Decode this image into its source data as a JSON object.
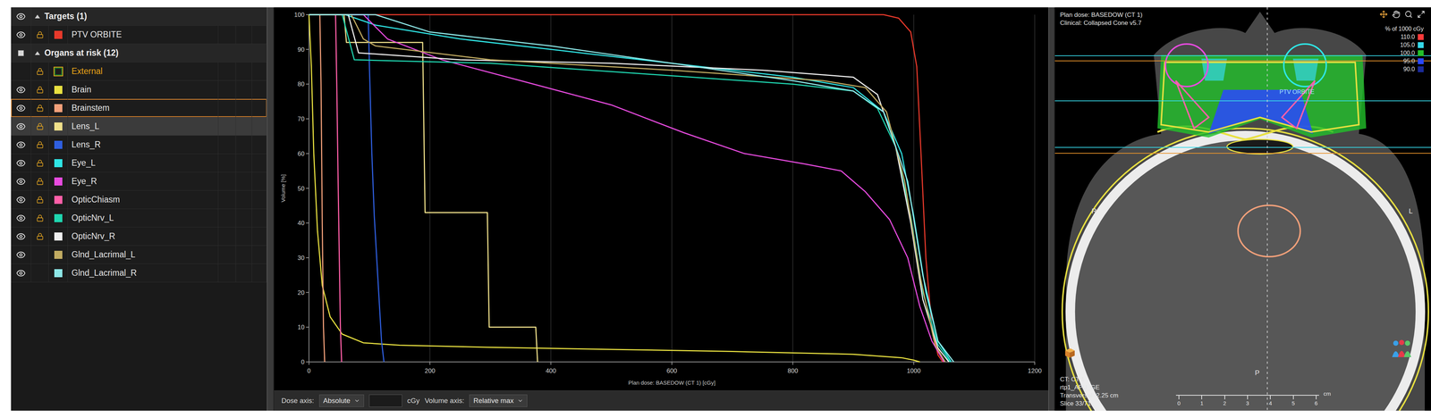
{
  "structures": {
    "groups": [
      {
        "label": "Targets (1)",
        "expanded": true,
        "visibility": "all",
        "items": [
          {
            "name": "PTV ORBITE",
            "color": "#e8392b",
            "text_color": "#e6e6e6",
            "kind": "filled",
            "visible": true,
            "locked": true,
            "selected": false,
            "highlighted": false,
            "dvh": [
              [
                0,
                100
              ],
              [
                950,
                100
              ],
              [
                975,
                99
              ],
              [
                995,
                95
              ],
              [
                1005,
                85
              ],
              [
                1012,
                60
              ],
              [
                1020,
                30
              ],
              [
                1030,
                10
              ],
              [
                1040,
                2
              ],
              [
                1048,
                0
              ]
            ]
          }
        ]
      },
      {
        "label": "Organs at risk (12)",
        "expanded": true,
        "visibility": "partial",
        "items": [
          {
            "name": "External",
            "color": "#1f7a2a",
            "text_color": "#e8a317",
            "kind": "outline",
            "visible": false,
            "locked": true,
            "selected": false,
            "highlighted": false,
            "dvh": []
          },
          {
            "name": "Brain",
            "color": "#e8e040",
            "text_color": "#e6e6e6",
            "kind": "filled",
            "visible": true,
            "locked": true,
            "selected": false,
            "highlighted": false,
            "dvh": [
              [
                0,
                100
              ],
              [
                4,
                85
              ],
              [
                8,
                60
              ],
              [
                14,
                38
              ],
              [
                22,
                22
              ],
              [
                35,
                13
              ],
              [
                55,
                8
              ],
              [
                90,
                5.5
              ],
              [
                150,
                4.8
              ],
              [
                300,
                4.2
              ],
              [
                500,
                3.6
              ],
              [
                700,
                3
              ],
              [
                900,
                2.2
              ],
              [
                980,
                1.2
              ],
              [
                1000,
                0.5
              ],
              [
                1010,
                0
              ]
            ]
          },
          {
            "name": "Brainstem",
            "color": "#f2a07a",
            "text_color": "#e6e6e6",
            "kind": "filled",
            "visible": true,
            "locked": true,
            "selected": true,
            "highlighted": false,
            "dvh": [
              [
                0,
                100
              ],
              [
                18,
                100
              ],
              [
                20,
                80
              ],
              [
                22,
                40
              ],
              [
                24,
                10
              ],
              [
                26,
                0
              ]
            ]
          },
          {
            "name": "Lens_L",
            "color": "#efe08a",
            "text_color": "#e6e6e6",
            "kind": "filled",
            "visible": true,
            "locked": true,
            "selected": false,
            "highlighted": true,
            "dvh": [
              [
                0,
                100
              ],
              [
                58,
                100
              ],
              [
                62,
                92
              ],
              [
                188,
                92
              ],
              [
                192,
                43
              ],
              [
                295,
                43
              ],
              [
                298,
                10
              ],
              [
                375,
                10
              ],
              [
                378,
                0
              ]
            ]
          },
          {
            "name": "Lens_R",
            "color": "#2f5fe0",
            "text_color": "#e6e6e6",
            "kind": "filled",
            "visible": true,
            "locked": true,
            "selected": false,
            "highlighted": false,
            "dvh": [
              [
                0,
                100
              ],
              [
                98,
                100
              ],
              [
                100,
                85
              ],
              [
                104,
                60
              ],
              [
                108,
                42
              ],
              [
                112,
                30
              ],
              [
                116,
                18
              ],
              [
                120,
                6
              ],
              [
                124,
                0
              ]
            ]
          },
          {
            "name": "Eye_L",
            "color": "#2fe6e6",
            "text_color": "#e6e6e6",
            "kind": "filled",
            "visible": true,
            "locked": true,
            "selected": false,
            "highlighted": false,
            "dvh": [
              [
                0,
                100
              ],
              [
                60,
                100
              ],
              [
                110,
                97
              ],
              [
                250,
                93
              ],
              [
                450,
                89
              ],
              [
                650,
                85
              ],
              [
                800,
                82
              ],
              [
                900,
                79
              ],
              [
                950,
                72
              ],
              [
                980,
                60
              ],
              [
                1000,
                42
              ],
              [
                1020,
                20
              ],
              [
                1040,
                6
              ],
              [
                1062,
                0
              ]
            ]
          },
          {
            "name": "Eye_R",
            "color": "#e84be0",
            "text_color": "#e6e6e6",
            "kind": "filled",
            "visible": true,
            "locked": true,
            "selected": false,
            "highlighted": false,
            "dvh": [
              [
                0,
                100
              ],
              [
                90,
                100
              ],
              [
                130,
                93
              ],
              [
                220,
                87
              ],
              [
                350,
                81
              ],
              [
                500,
                74
              ],
              [
                620,
                66
              ],
              [
                720,
                60
              ],
              [
                820,
                57
              ],
              [
                880,
                55
              ],
              [
                920,
                49
              ],
              [
                960,
                41
              ],
              [
                990,
                30
              ],
              [
                1010,
                16
              ],
              [
                1030,
                6
              ],
              [
                1050,
                0
              ]
            ]
          },
          {
            "name": "OpticChiasm",
            "color": "#ff5fa8",
            "text_color": "#e6e6e6",
            "kind": "filled",
            "visible": true,
            "locked": true,
            "selected": false,
            "highlighted": false,
            "dvh": [
              [
                0,
                100
              ],
              [
                44,
                100
              ],
              [
                46,
                80
              ],
              [
                48,
                55
              ],
              [
                50,
                32
              ],
              [
                52,
                10
              ],
              [
                54,
                0
              ]
            ]
          },
          {
            "name": "OpticNrv_L",
            "color": "#1fd6b0",
            "text_color": "#e6e6e6",
            "kind": "filled",
            "visible": true,
            "locked": true,
            "selected": false,
            "highlighted": false,
            "dvh": [
              [
                0,
                100
              ],
              [
                55,
                100
              ],
              [
                75,
                87
              ],
              [
                300,
                86
              ],
              [
                550,
                83
              ],
              [
                800,
                80
              ],
              [
                900,
                78
              ],
              [
                940,
                73
              ],
              [
                970,
                62
              ],
              [
                995,
                42
              ],
              [
                1015,
                20
              ],
              [
                1040,
                5
              ],
              [
                1060,
                0
              ]
            ]
          },
          {
            "name": "OpticNrv_R",
            "color": "#f0f0f0",
            "text_color": "#e6e6e6",
            "kind": "filled",
            "visible": true,
            "locked": true,
            "selected": false,
            "highlighted": false,
            "dvh": [
              [
                0,
                100
              ],
              [
                65,
                100
              ],
              [
                82,
                89
              ],
              [
                250,
                87
              ],
              [
                500,
                86
              ],
              [
                750,
                84
              ],
              [
                900,
                82
              ],
              [
                940,
                77
              ],
              [
                970,
                62
              ],
              [
                995,
                40
              ],
              [
                1015,
                18
              ],
              [
                1040,
                4
              ],
              [
                1058,
                0
              ]
            ]
          },
          {
            "name": "Glnd_Lacrimal_L",
            "color": "#c2ac62",
            "text_color": "#e6e6e6",
            "kind": "filled",
            "visible": true,
            "locked": false,
            "selected": false,
            "highlighted": false,
            "dvh": [
              [
                0,
                100
              ],
              [
                70,
                100
              ],
              [
                90,
                93
              ],
              [
                110,
                91
              ],
              [
                300,
                87
              ],
              [
                600,
                84
              ],
              [
                850,
                81
              ],
              [
                920,
                79
              ],
              [
                955,
                72
              ],
              [
                985,
                52
              ],
              [
                1010,
                25
              ],
              [
                1035,
                5
              ],
              [
                1052,
                0
              ]
            ]
          },
          {
            "name": "Glnd_Lacrimal_R",
            "color": "#8ee8e8",
            "text_color": "#e6e6e6",
            "kind": "filled",
            "visible": true,
            "locked": false,
            "selected": false,
            "highlighted": false,
            "dvh": [
              [
                0,
                100
              ],
              [
                110,
                100
              ],
              [
                200,
                95
              ],
              [
                400,
                91
              ],
              [
                600,
                86
              ],
              [
                800,
                81
              ],
              [
                900,
                78
              ],
              [
                950,
                72
              ],
              [
                990,
                52
              ],
              [
                1015,
                25
              ],
              [
                1040,
                6
              ],
              [
                1066,
                0
              ]
            ]
          }
        ]
      }
    ]
  },
  "dvh_chart": {
    "x_axis": {
      "title": "Plan dose: BASEDOW (CT 1) [cGy]",
      "ticks": [
        "0",
        "200",
        "400",
        "600",
        "800",
        "1000",
        "1200"
      ]
    },
    "y_axis": {
      "title": "Volume [%]",
      "ticks": [
        "0",
        "10",
        "20",
        "30",
        "40",
        "50",
        "60",
        "70",
        "80",
        "90",
        "100"
      ]
    }
  },
  "chart_toolbar": {
    "dose_axis_label": "Dose axis:",
    "dose_axis_value": "Absolute",
    "dose_input": "",
    "dose_unit": "cGy",
    "volume_axis_label": "Volume axis:",
    "volume_axis_value": "Relative max"
  },
  "viewer": {
    "title_lines": [
      "Plan dose: BASEDOW (CT 1)",
      "Clinical: Collapsed Cone v5.7"
    ],
    "legend": {
      "title": "% of 1000 cGy",
      "items": [
        {
          "label": "110.0",
          "color": "#ff3a3a"
        },
        {
          "label": "105.0",
          "color": "#36d8e8"
        },
        {
          "label": "100.0",
          "color": "#22c02a"
        },
        {
          "label": "95.0",
          "color": "#2a48ff"
        },
        {
          "label": "90.0",
          "color": "#1a2a9a"
        }
      ]
    },
    "roi_label": "PTV ORBITE",
    "orientation": {
      "right": "R",
      "left": "L",
      "posterior": "P"
    },
    "info_lines": [
      "CT: CT 1",
      "rtp1_APU_GE",
      "Transversal -2.25 cm",
      "Slice 33/71"
    ],
    "scale": {
      "ticks": [
        "0",
        "1",
        "2",
        "3",
        "4",
        "5",
        "6"
      ],
      "unit": "cm"
    }
  }
}
